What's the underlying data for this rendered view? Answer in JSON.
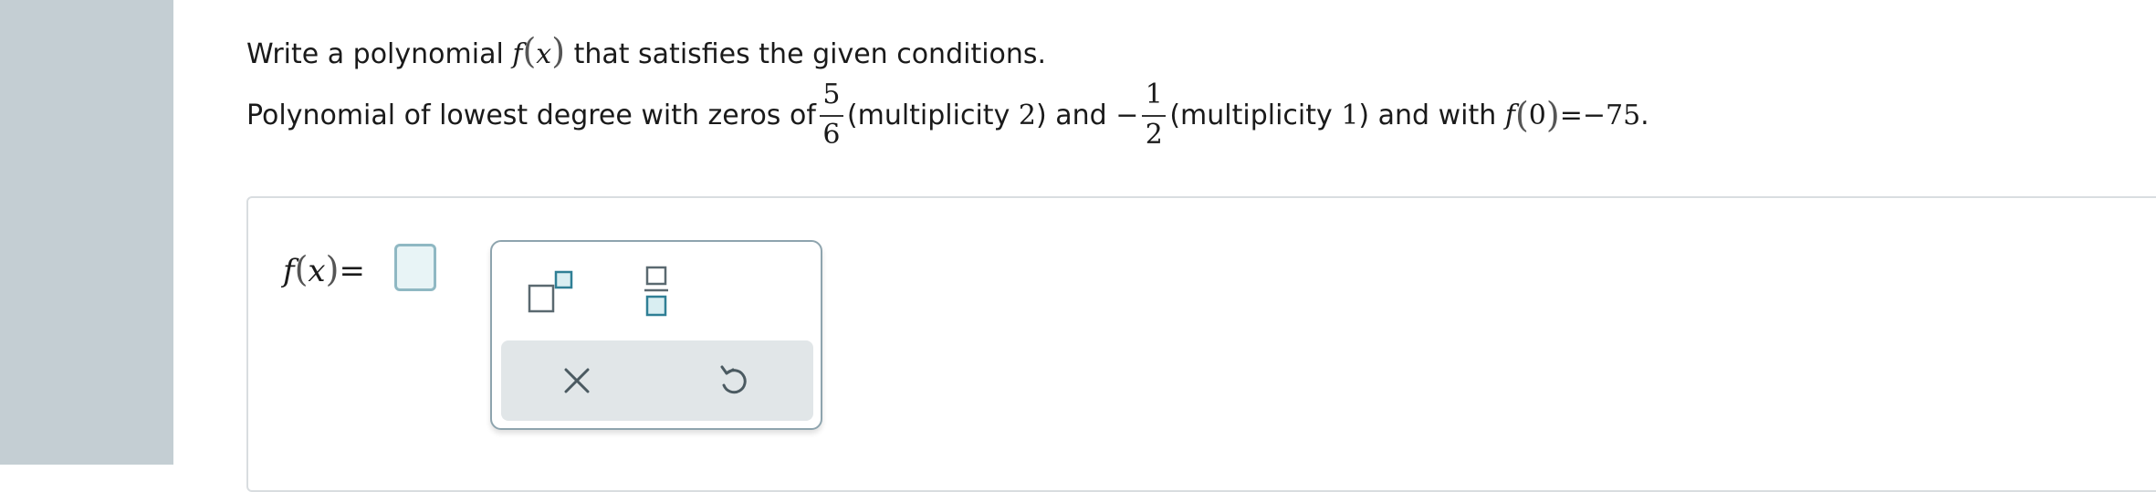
{
  "question": {
    "line1_prefix": "Write a polynomial",
    "fx_f": "f",
    "fx_x": "x",
    "line1_suffix": "that satisfies the given conditions.",
    "line2_intro": "Polynomial of lowest degree with zeros of",
    "zero1": {
      "numerator": "5",
      "denominator": "6"
    },
    "mult1_prefix": "(multiplicity",
    "mult1_value": "2",
    "mult1_suffix": ") and",
    "minus_sign": "−",
    "zero2": {
      "numerator": "1",
      "denominator": "2"
    },
    "mult2_prefix": "(multiplicity",
    "mult2_value": "1",
    "mult2_suffix": ") and with",
    "cond_f": "f",
    "cond_arg": "0",
    "cond_equals": "=",
    "cond_value": "−75",
    "cond_period": "."
  },
  "answer": {
    "label_f": "f",
    "label_x": "x",
    "equals": "=",
    "value": ""
  },
  "palette": {
    "tools": [
      "superscript-icon",
      "fraction-icon",
      "clear-icon",
      "undo-icon"
    ]
  },
  "colors": {
    "left_rail": "#c4ced3",
    "accent": "#8fb8c3",
    "answer_box_fill": "#e8f4f6",
    "palette_border": "#8ea4ae",
    "toolbar_fill": "#e1e6e8"
  }
}
